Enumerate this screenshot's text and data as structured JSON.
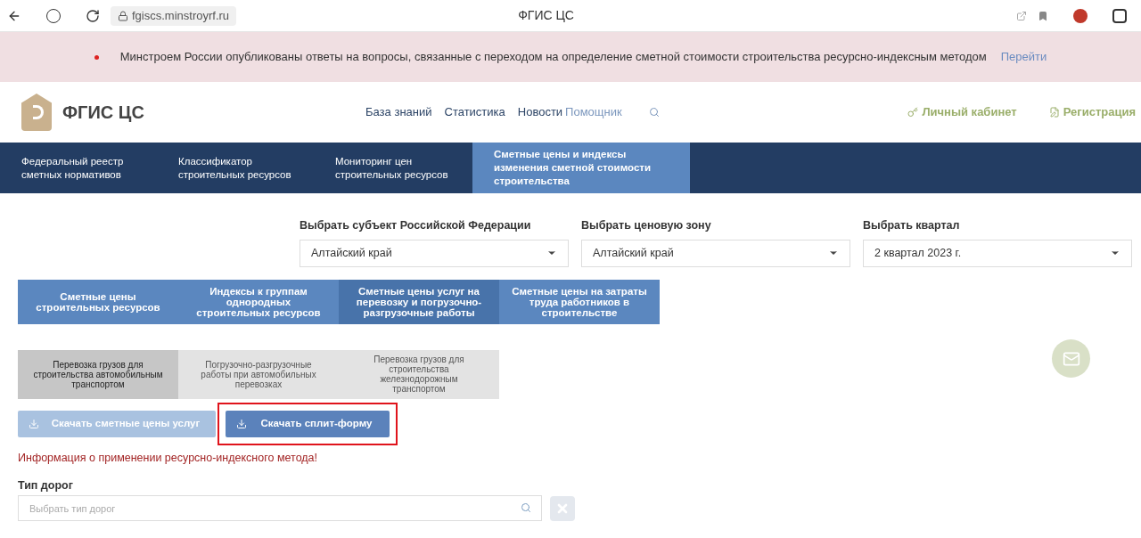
{
  "browser": {
    "url": "fgiscs.minstroyrf.ru",
    "title": "ФГИС ЦС"
  },
  "banner": {
    "text": "Минстроем России опубликованы ответы на вопросы, связанные с переходом на определение сметной стоимости строительства ресурсно-индексным методом",
    "link": "Перейти"
  },
  "header": {
    "logo": "ФГИС ЦС",
    "links": [
      {
        "label": "База знаний",
        "muted": false
      },
      {
        "label": "Статистика",
        "muted": false
      },
      {
        "label": "Новости",
        "muted": false
      },
      {
        "label": "Помощник",
        "muted": true
      }
    ],
    "account": "Личный кабинет",
    "register": "Регистрация"
  },
  "nav": [
    {
      "label": "Федеральный реестр сметных нормативов",
      "selected": false
    },
    {
      "label": "Классификатор строительных ресурсов",
      "selected": false
    },
    {
      "label": "Мониторинг цен строительных ресурсов",
      "selected": false
    },
    {
      "label": "Сметные цены и индексы изменения сметной стоимости строительства",
      "selected": true
    }
  ],
  "filters": [
    {
      "label": "Выбрать субъект Российской Федерации",
      "value": "Алтайский край"
    },
    {
      "label": "Выбрать ценовую зону",
      "value": "Алтайский край"
    },
    {
      "label": "Выбрать квартал",
      "value": "2 квартал 2023 г."
    }
  ],
  "categories": [
    {
      "label": "Сметные цены строительных ресурсов",
      "selected": false
    },
    {
      "label": "Индексы к группам однородных строительных ресурсов",
      "selected": false
    },
    {
      "label": "Сметные цены услуг на перевозку и погрузочно-разгрузочные работы",
      "selected": true
    },
    {
      "label": "Сметные цены на затраты труда работников в строительстве",
      "selected": false
    }
  ],
  "subtabs": [
    {
      "label": "Перевозка грузов для строительства автомобильным транспортом",
      "selected": true
    },
    {
      "label": "Погрузочно-разгрузочные работы при автомобильных перевозках",
      "selected": false
    },
    {
      "label": "Перевозка грузов для строительства железнодорожным транспортом",
      "selected": false
    }
  ],
  "downloads": [
    {
      "label": "Скачать сметные цены услуг",
      "disabled": true,
      "highlighted": false
    },
    {
      "label": "Скачать сплит-форму",
      "disabled": false,
      "highlighted": true
    }
  ],
  "info": "Информация о применении ресурсно-индексного метода!",
  "road_type": {
    "label": "Тип дорог",
    "placeholder": "Выбрать тип дорог"
  }
}
